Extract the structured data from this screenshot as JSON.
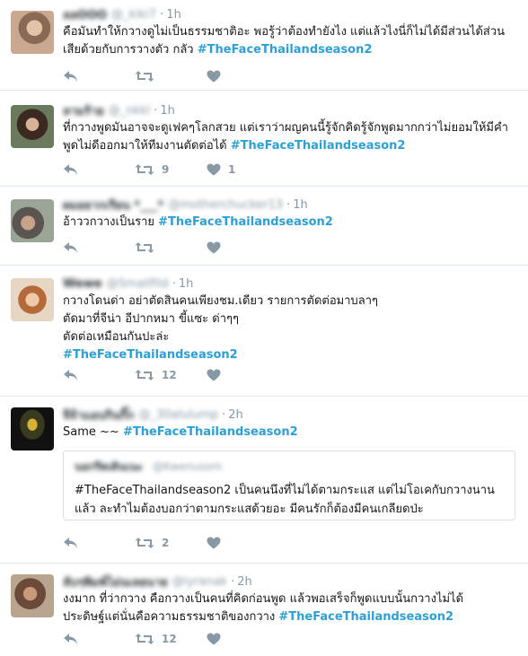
{
  "tweets": [
    {
      "name": "ลลOOO",
      "handle": "@_kiki7",
      "time": "1h",
      "text_prefix": "คือมันทำให้กวางดูไม่เป็นธรรมชาติอะ พอรู้ว่าต้องทำยังไง แต่แล้วไงนี่ก็ไม่ได้มีส่วนได้ส่วน\nเสียด้วยกับการวางตัว กลัว ",
      "hashtag": "#TheFaceThailandseason2",
      "retweets": "",
      "likes": ""
    },
    {
      "name": "ลามร้าย",
      "handle": "@_nkkl",
      "time": "1h",
      "text_prefix": "ที่กวางพูดมันอาจจะดูเฟคๆโลกสวย แต่เราว่าผญคนนี้รู้จักคิดรู้จักพูดมากกว่าไม่ยอมให้มีคำ\nพูดไม่ดีออกมาให้ทีมงานตัดต่อได้ ",
      "hashtag": "#TheFaceThailandseason2",
      "retweets": "9",
      "likes": "1"
    },
    {
      "name": "ผมอยากเรียน *___*",
      "handle": "@motherchucker13",
      "time": "1h",
      "text_prefix": "อ้าววกวางเป็นราย ",
      "hashtag": "#TheFaceThailandseason2",
      "retweets": "",
      "likes": ""
    },
    {
      "name": "Wewe",
      "handle": "@Smallfild",
      "time": "1h",
      "text_prefix": "กวางโดนด่า อย่าตัดสินคนเพียงชม.เดียว รายการตัดต่อมาบลาๆ\nตัดมาที่จีน่า อีปากหมา ขี้แซะ ด่าๆๆ\nตัดต่อเหมือนกันปะล่ะ\n",
      "hashtag": "#TheFaceThailandseason2",
      "retweets": "12",
      "likes": ""
    },
    {
      "name": "จีจ้าแอบกินกิ๊ก",
      "handle": "@_30alulump",
      "time": "2h",
      "text_prefix": "Same ~~ ",
      "hashtag": "#TheFaceThailandseason2",
      "retweets": "2",
      "likes": "",
      "quote": {
        "name": "นอกรีตเดินเนะ",
        "handle": "@Kwenusom",
        "text": "#TheFaceThailandseason2 เป็นคนนึงที่ไม่ได้ตามกระแส แต่ไม่โอเคกับกวางนาน\nแล้ว ละทำไมต้องบอกว่าตามกระแสด้วยอะ มีคนรักก็ต้องมีคนเกลียดป่ะ"
      }
    },
    {
      "name": "ลับๆพิมพ์ไม่นเลยนาย",
      "handle": "@lyranak",
      "time": "2h",
      "text_prefix": "งงมาก ที่ว่ากวาง คือกวางเป็นคนที่คิดก่อนพูด แล้วพอเสร็จก็พูดแบบนั้นกวางไม่ได้\nประดิษฐ์แต่นั่นคือความธรรมชาติของกวาง ",
      "hashtag": "#TheFaceThailandseason2",
      "retweets": "12",
      "likes": ""
    }
  ],
  "icons": {
    "reply": "reply-icon",
    "retweet": "retweet-icon",
    "like": "heart-icon"
  },
  "colors": {
    "hashtag": "#2b9fd6",
    "meta": "#8899a6",
    "divider": "#e1e8ed"
  }
}
